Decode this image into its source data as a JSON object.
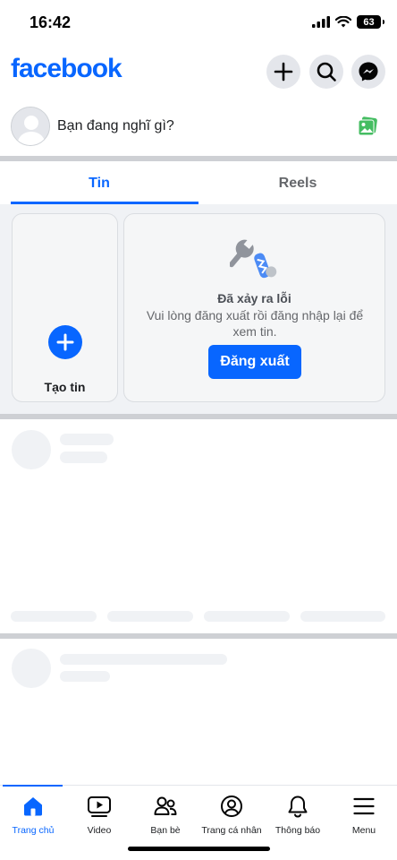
{
  "status_bar": {
    "time": "16:42",
    "battery": "63",
    "icons": [
      "signal-icon",
      "wifi-icon",
      "battery-icon"
    ]
  },
  "header": {
    "logo": "facebook",
    "buttons": [
      "plus-icon",
      "search-icon",
      "messenger-icon"
    ]
  },
  "composer": {
    "placeholder": "Bạn đang nghĩ gì?",
    "photo_icon": "photo-icon"
  },
  "tabs": [
    {
      "label": "Tin",
      "active": true
    },
    {
      "label": "Reels",
      "active": false
    }
  ],
  "stories": {
    "create_label": "Tạo tin",
    "error_title": "Đã xảy ra lỗi",
    "error_message": "Vui lòng đăng xuất rồi đăng nhập lại để xem tin.",
    "logout_label": "Đăng xuất",
    "error_icon": "wrench-icon"
  },
  "bottom_nav": [
    {
      "label": "Trang chủ",
      "icon": "home-icon",
      "active": true
    },
    {
      "label": "Video",
      "icon": "video-icon",
      "active": false
    },
    {
      "label": "Bạn bè",
      "icon": "friends-icon",
      "active": false
    },
    {
      "label": "Trang cá nhân",
      "icon": "profile-icon",
      "active": false
    },
    {
      "label": "Thông báo",
      "icon": "bell-icon",
      "active": false
    },
    {
      "label": "Menu",
      "icon": "menu-icon",
      "active": false
    }
  ],
  "colors": {
    "brand": "#0866ff",
    "divider": "#ced0d4",
    "skeleton": "#f0f2f5"
  }
}
